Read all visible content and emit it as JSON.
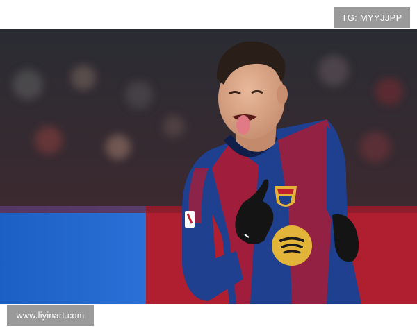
{
  "watermark_top": "TG: MYYJJPP",
  "watermark_bottom": "www.liyinart.com",
  "photo": {
    "subject": "football-player-celebrating",
    "colors": {
      "kit_blue": "#1f3f8f",
      "kit_red": "#a01e3c",
      "sponsor_yellow": "#e2b53a",
      "glove_black": "#141414",
      "board_blue": "#1e63c9",
      "board_red": "#b01f2f"
    }
  }
}
